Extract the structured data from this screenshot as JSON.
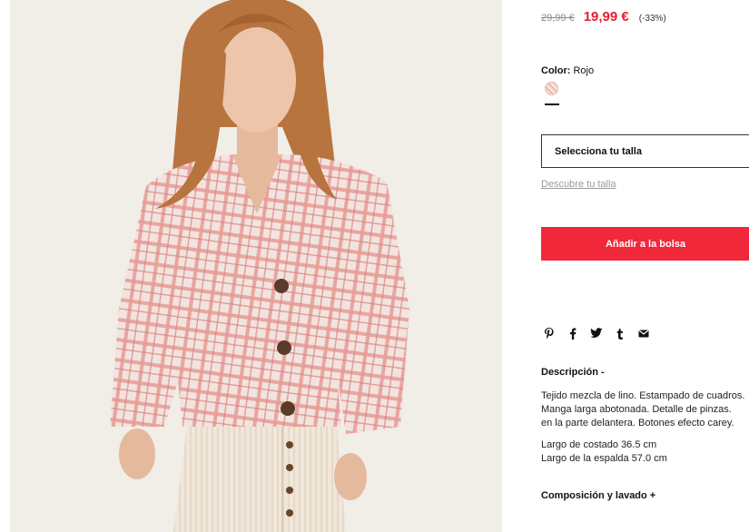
{
  "product": {
    "image_alt": "Model wearing pink check blouse and cream corduroy trousers",
    "old_price": "29,99 €",
    "new_price": "19,99 €",
    "discount": "(-33%)"
  },
  "color": {
    "label": "Color:",
    "value": "Rojo"
  },
  "size": {
    "select_label": "Selecciona tu talla",
    "guide_link": "Descubre tu talla"
  },
  "actions": {
    "add_to_bag": "Añadir a la bolsa"
  },
  "share": {
    "icons": [
      "pinterest-icon",
      "facebook-icon",
      "twitter-icon",
      "tumblr-icon",
      "email-icon"
    ]
  },
  "description": {
    "title": "Descripción -",
    "lines": [
      "Tejido mezcla de lino. Estampado de cuadros.",
      "Manga larga abotonada. Detalle de pinzas.",
      "en la parte delantera. Botones efecto carey."
    ],
    "measure_lines": [
      "Largo de costado 36.5 cm",
      "Largo de la espalda 57.0 cm"
    ]
  },
  "composition": {
    "title": "Composición y lavado +"
  },
  "colors": {
    "accent": "#F0283A",
    "sale_price": "#E3202F"
  }
}
